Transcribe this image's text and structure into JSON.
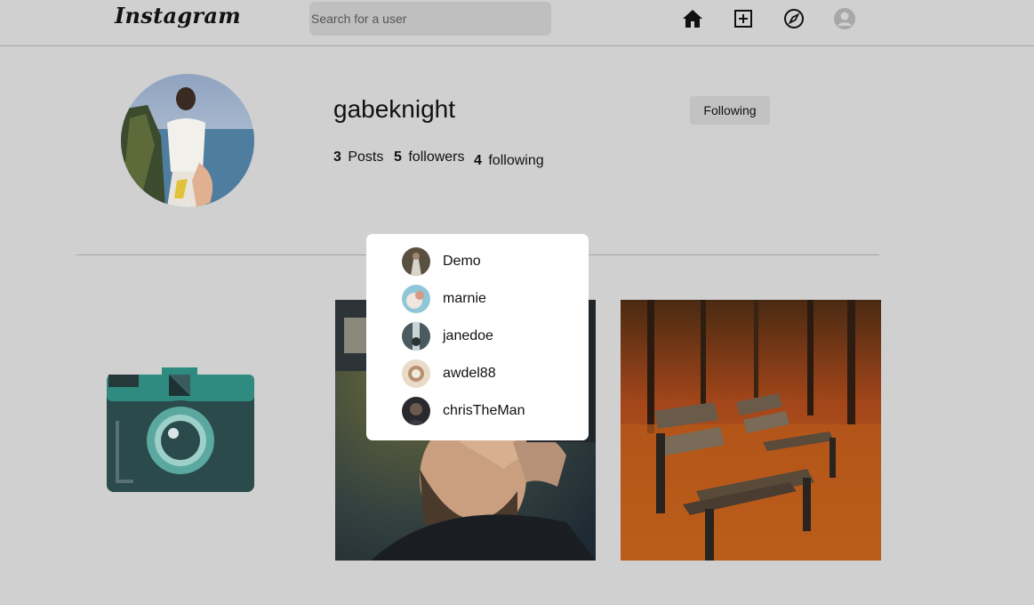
{
  "nav": {
    "logo": "Instagram",
    "search_placeholder": "Search for a user",
    "icons": [
      "home-icon",
      "add-post-icon",
      "explore-icon",
      "profile-icon"
    ]
  },
  "profile": {
    "username": "gabeknight",
    "follow_button": "Following",
    "posts_count": "3",
    "posts_label": "Posts",
    "followers_count": "5",
    "followers_label": "followers",
    "following_count": "4",
    "following_label": "following"
  },
  "followers_popup": {
    "users": [
      {
        "name": "Demo"
      },
      {
        "name": "marnie"
      },
      {
        "name": "janedoe"
      },
      {
        "name": "awdel88"
      },
      {
        "name": "chrisTheMan"
      }
    ]
  },
  "colors": {
    "background": "#d0d0d0",
    "camera_teal": "#2f8a80",
    "camera_dark": "#2b4a4c"
  }
}
